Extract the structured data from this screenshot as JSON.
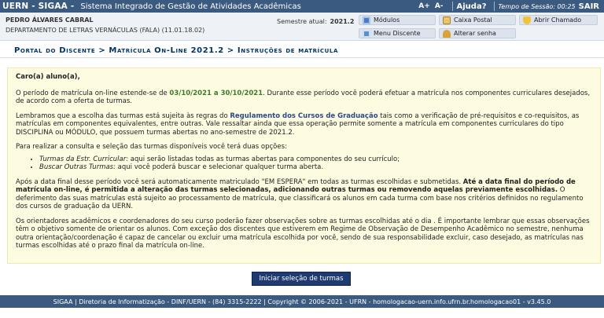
{
  "topbar": {
    "brand": "UERN - SIGAA -",
    "system": "Sistema Integrado de Gestão de Atividades Acadêmicas",
    "font_up": "A+",
    "font_down": "A-",
    "help": "Ajuda?",
    "session_label": "Tempo de Sessão: 00:25",
    "logout": "SAIR"
  },
  "user": {
    "name": "PEDRO ÁLVARES CABRAL",
    "department": "DEPARTAMENTO DE LETRAS VERNÁCULAS (FALA) (11.01.18.02)",
    "semester_label": "Semestre atual:",
    "semester_value": "2021.2"
  },
  "menu": {
    "modulos": "Módulos",
    "caixa_postal": "Caixa Postal",
    "abrir_chamado": "Abrir Chamado",
    "menu_discente": "Menu Discente",
    "alterar_senha": "Alterar senha"
  },
  "breadcrumb": "Portal do Discente > Matrícula On-Line 2021.2 > Instruções de matrícula",
  "content": {
    "greeting": "Caro(a) aluno(a),",
    "p1_a": "O período de matrícula on-line estende-se de ",
    "p1_dates": "03/10/2021 a 30/10/2021",
    "p1_b": ". Durante esse período você poderá efetuar a matrícula nos componentes curriculares desejados, de acordo com a oferta de turmas.",
    "p2_a": "Lembramos que a escolha das turmas está sujeita às regras do ",
    "p2_link": "Regulamento dos Cursos de Graduação",
    "p2_b": " tais como a verificação de pré-requisitos e co-requisitos, as matrículas em componentes equivalentes, entre outras. Vale ressaltar ainda que essa operação permite somente a matrícula em componentes curriculares do tipo DISCIPLINA ou MÓDULO, que possuem turmas abertas no ano-semestre de 2021.2.",
    "p3": "Para realizar a consulta e seleção das turmas disponíveis você terá duas opções:",
    "opt1_label": "Turmas da Estr. Curricular:",
    "opt1_text": " aqui serão listadas todas as turmas abertas para componentes do seu currículo;",
    "opt2_label": "Buscar Outras Turmas:",
    "opt2_text": " aqui você poderá buscar e selecionar qualquer turma aberta.",
    "p4_a": "Após a data final desse período você será automaticamente matriculado \"EM ESPERA\" em todas as turmas escolhidas e submetidas. ",
    "p4_bold": "Até a data final do período de matrícula on-line, é permitida a alteração das turmas selecionadas, adicionando outras turmas ou removendo aquelas previamente escolhidas.",
    "p4_b": " O deferimento das suas matrículas está sujeito ao processamento de matrícula, que classificará os alunos em cada turma com base nos critérios definidos no regulamento dos cursos de graduação da UERN.",
    "p5": "Os orientadores acadêmicos e coordenadores do seu curso poderão fazer observações sobre as turmas escolhidas até o dia . É importante lembrar que essas observações têm o objetivo somente de orientar os alunos. Com exceção dos discentes que estiverem em Regime de Observação de Desempenho Acadêmico no semestre, nenhuma outra orientação/coordenação é capaz de cancelar ou excluir uma matrícula escolhida por você, sendo de sua responsabilidade excluir, caso desejado, as matrículas nas turmas escolhidas até o prazo final da matrícula on-line."
  },
  "start_button": "Iniciar seleção de turmas",
  "footer": "SIGAA | Diretoria de Informatização - DINF/UERN - (84) 3315-2222 | Copyright © 2006-2021 - UFRN - homologacao-uern.info.ufrn.br.homologacao01 - v3.45.0",
  "colors": {
    "topbar": "#3b5a80",
    "content_bg": "#fefce0",
    "date_green": "#3c7a2c",
    "button_blue": "#1f3a70"
  },
  "icons": [
    "modulos-icon",
    "mail-icon",
    "bell-icon",
    "menu-icon",
    "key-icon"
  ]
}
